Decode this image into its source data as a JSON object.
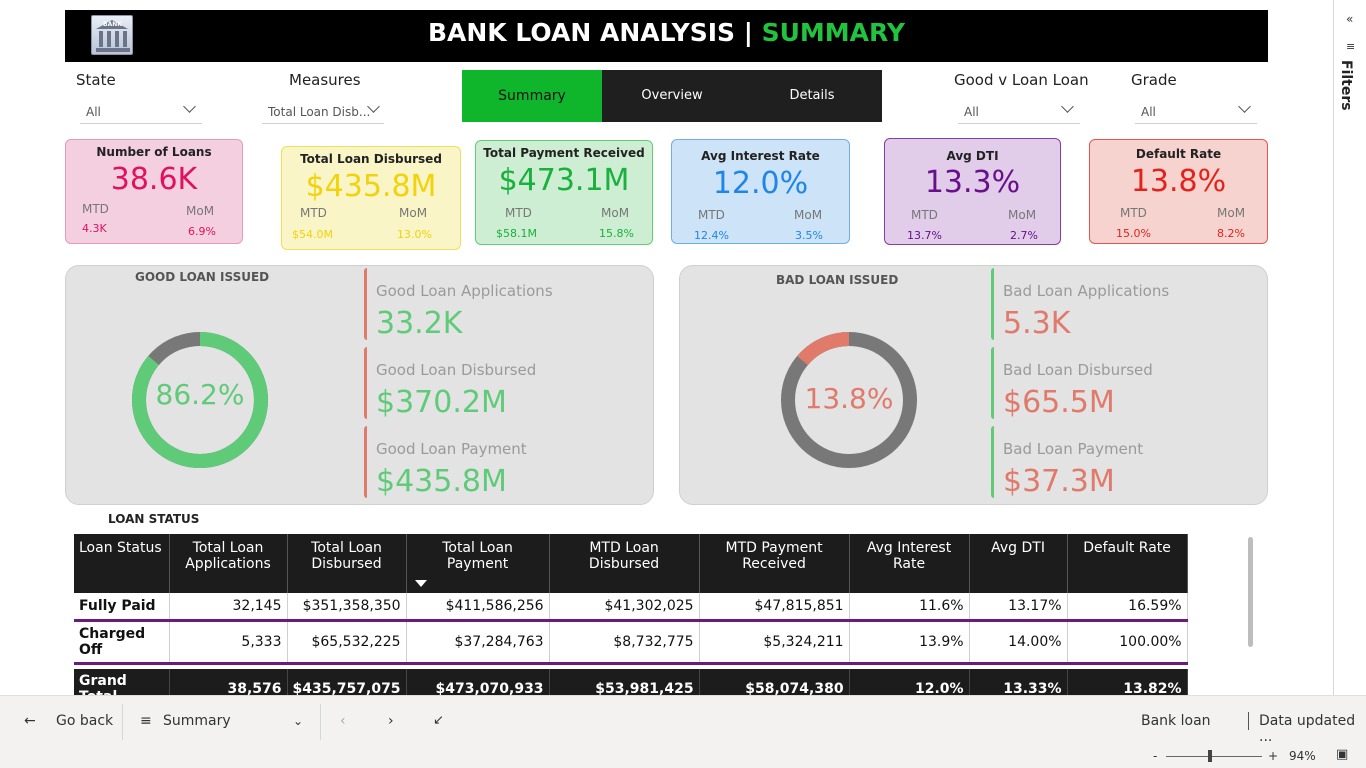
{
  "header": {
    "title_main": "BANK LOAN ANALYSIS | ",
    "title_accent": "SUMMARY",
    "logo_text": "BANK"
  },
  "slicers": {
    "state": {
      "label": "State",
      "value": "All"
    },
    "measures": {
      "label": "Measures",
      "value": "Total Loan Disb..."
    },
    "good_v_loan": {
      "label": "Good v Loan Loan",
      "value": "All"
    },
    "grade": {
      "label": "Grade",
      "value": "All"
    }
  },
  "nav": {
    "summary": "Summary",
    "overview": "Overview",
    "details": "Details"
  },
  "kpis": [
    {
      "title": "Number of Loans",
      "value": "38.6K",
      "mtd_label": "MTD",
      "mom_label": "MoM",
      "mtd": "4.3K",
      "mom": "6.9%",
      "color": "#e0115f",
      "bg": "#f3cfe0",
      "border": "#e79ab8"
    },
    {
      "title": "Total Loan Disbursed",
      "value": "$435.8M",
      "mtd_label": "MTD",
      "mom_label": "MoM",
      "mtd": "$54.0M",
      "mom": "13.0%",
      "color": "#f2d20c",
      "bg": "#faf5c6",
      "border": "#efe05a"
    },
    {
      "title": "Total Payment Received",
      "value": "$473.1M",
      "mtd_label": "MTD",
      "mom_label": "MoM",
      "mtd": "$58.1M",
      "mom": "15.8%",
      "color": "#19b03b",
      "bg": "#cdeed3",
      "border": "#5fcf73"
    },
    {
      "title": "Avg Interest Rate",
      "value": "12.0%",
      "mtd_label": "MTD",
      "mom_label": "MoM",
      "mtd": "12.4%",
      "mom": "3.5%",
      "color": "#1e86e8",
      "bg": "#cde3f7",
      "border": "#6eaee9"
    },
    {
      "title": "Avg DTI",
      "value": "13.3%",
      "mtd_label": "MTD",
      "mom_label": "MoM",
      "mtd": "13.7%",
      "mom": "2.7%",
      "color": "#6a0f8a",
      "bg": "#e1cde9",
      "border": "#8a3aa7"
    },
    {
      "title": "Default Rate",
      "value": "13.8%",
      "mtd_label": "MTD",
      "mom_label": "MoM",
      "mtd": "15.0%",
      "mom": "8.2%",
      "color": "#e3231b",
      "bg": "#f6d3cf",
      "border": "#e4574f"
    }
  ],
  "good_loan": {
    "title": "GOOD LOAN ISSUED",
    "percent_label": "86.2%",
    "percent": 0.862,
    "color": "#5fcb78",
    "applications_label": "Good Loan Applications",
    "applications": "33.2K",
    "disbursed_label": "Good Loan Disbursed",
    "disbursed": "$370.2M",
    "payment_label": "Good Loan Payment",
    "payment": "$435.8M"
  },
  "bad_loan": {
    "title": "BAD LOAN ISSUED",
    "percent_label": "13.8%",
    "percent": 0.138,
    "color": "#e07a6a",
    "applications_label": "Bad Loan Applications",
    "applications": "5.3K",
    "disbursed_label": "Bad Loan Disbursed",
    "disbursed": "$65.5M",
    "payment_label": "Bad Loan Payment",
    "payment": "$37.3M"
  },
  "table": {
    "title": "LOAN STATUS",
    "headers": [
      "Loan Status",
      "Total Loan Applications",
      "Total Loan Disbursed",
      "Total Loan Payment",
      "MTD Loan Disbursed",
      "MTD Payment Received",
      "Avg Interest Rate",
      "Avg DTI",
      "Default Rate"
    ],
    "rows": [
      [
        "Fully Paid",
        "32,145",
        "$351,358,350",
        "$411,586,256",
        "$41,302,025",
        "$47,815,851",
        "11.6%",
        "13.17%",
        "16.59%"
      ],
      [
        "Charged Off",
        "5,333",
        "$65,532,225",
        "$37,284,763",
        "$8,732,775",
        "$5,324,211",
        "13.9%",
        "14.00%",
        "100.00%"
      ]
    ],
    "total": [
      "Grand Total",
      "38,576",
      "$435,757,075",
      "$473,070,933",
      "$53,981,425",
      "$58,074,380",
      "12.0%",
      "13.33%",
      "13.82%"
    ]
  },
  "filters_pane": {
    "label": "Filters",
    "collapse": "«"
  },
  "bottombar": {
    "go_back": "Go back",
    "page": "Summary",
    "report_name": "Bank loan",
    "data_updated": "Data updated ..."
  },
  "statusbar": {
    "zoom_minus": "-",
    "zoom_plus": "+",
    "zoom": "94%"
  }
}
